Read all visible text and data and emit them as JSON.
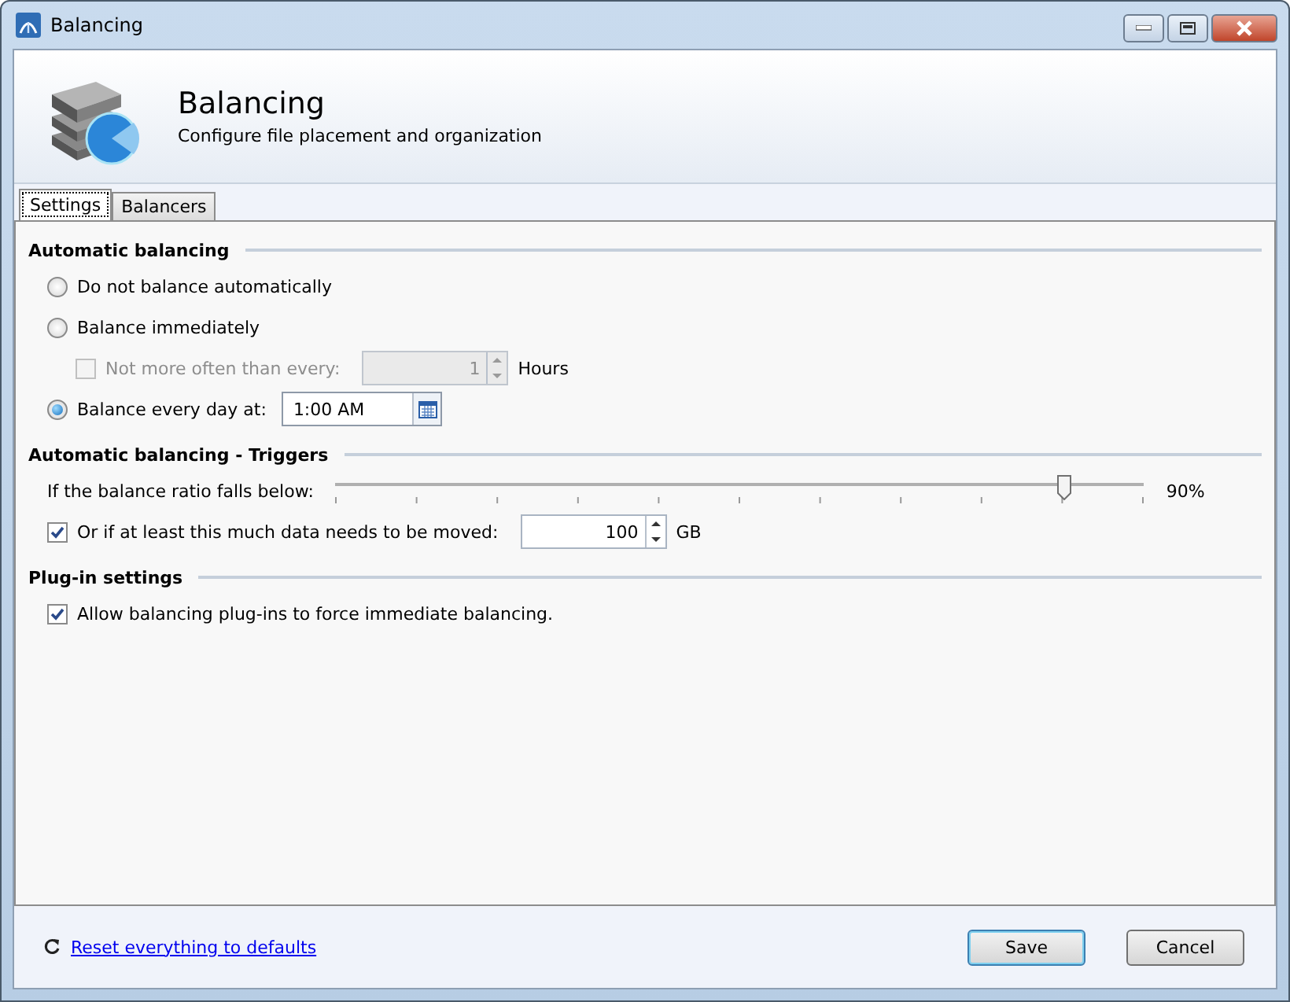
{
  "window": {
    "title": "Balancing"
  },
  "header": {
    "title": "Balancing",
    "subtitle": "Configure file placement and organization"
  },
  "tabs": [
    {
      "label": "Settings",
      "selected": true
    },
    {
      "label": "Balancers",
      "selected": false
    }
  ],
  "sections": [
    {
      "title": "Automatic balancing",
      "rows": [
        {
          "kind": "radio",
          "label": "Do not balance automatically",
          "selected": false
        },
        {
          "kind": "radio",
          "label": "Balance immediately",
          "selected": false
        },
        {
          "kind": "spin",
          "label": "Not more often than every:",
          "checked": false,
          "disabled": true,
          "value": "1",
          "unit": "Hours",
          "indent": true
        },
        {
          "kind": "time",
          "label": "Balance every day at:",
          "selected": true,
          "value": "1:00 AM"
        }
      ]
    },
    {
      "title": "Automatic balancing - Triggers",
      "rows": [
        {
          "kind": "slider",
          "label": "If the balance ratio falls below:",
          "level": 0.9,
          "reading": "90%"
        },
        {
          "kind": "spin",
          "label": "Or if at least this much data needs to be moved:",
          "checked": true,
          "disabled": false,
          "value": "100",
          "unit": "GB",
          "indent": false
        }
      ]
    },
    {
      "title": "Plug-in settings",
      "rows": [
        {
          "kind": "check",
          "label": "Allow balancing plug-ins to force immediate balancing.",
          "checked": true
        }
      ]
    }
  ],
  "footer": {
    "link": "Reset everything to defaults",
    "buttons": [
      {
        "label": "Save",
        "default": true
      },
      {
        "label": "Cancel",
        "default": false
      }
    ]
  }
}
